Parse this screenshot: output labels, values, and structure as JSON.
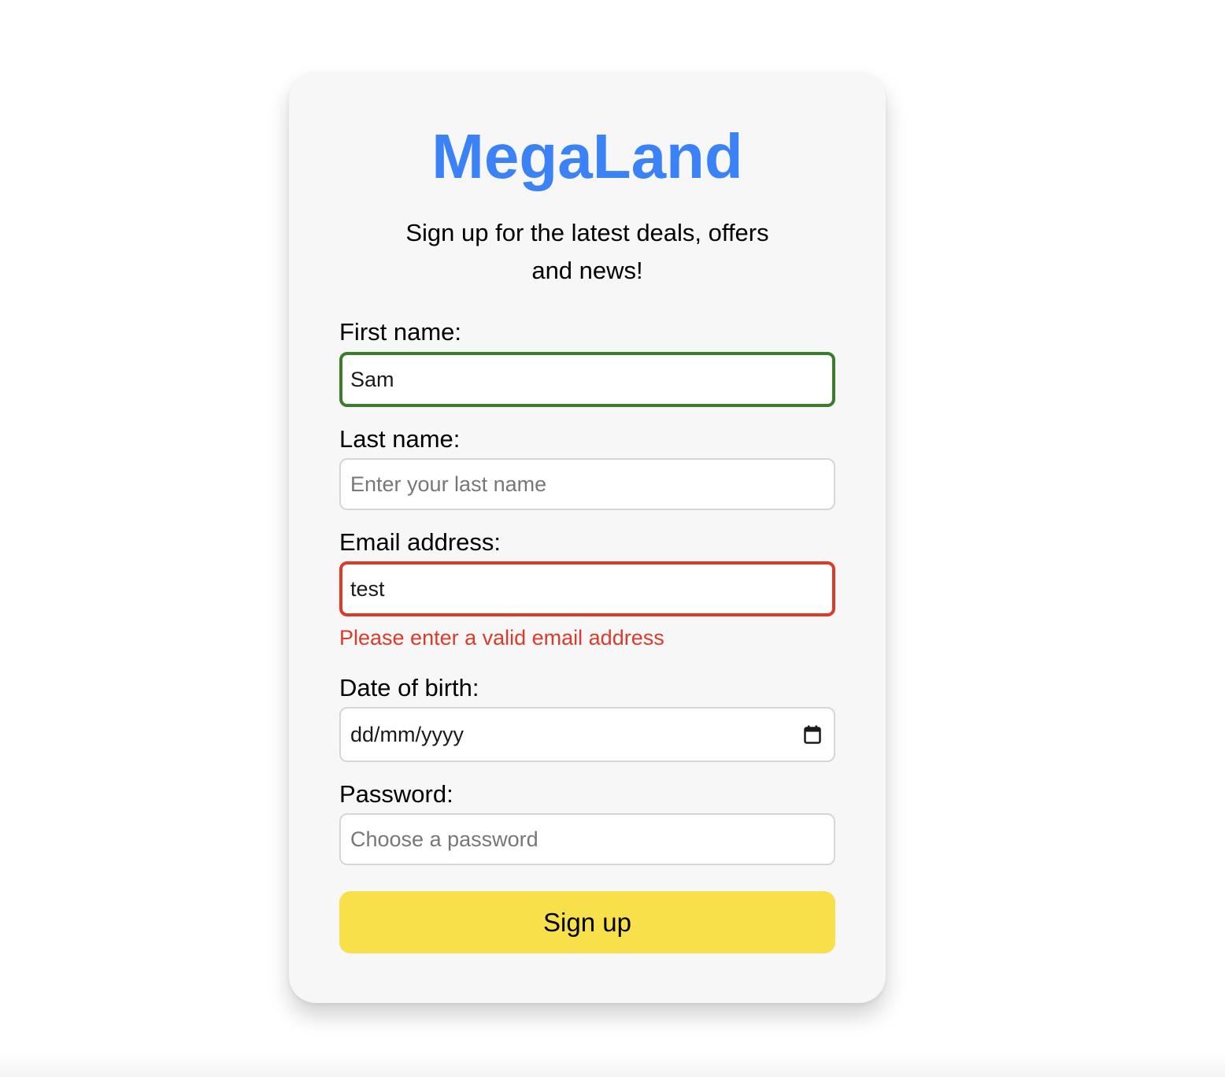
{
  "brand": {
    "title": "MegaLand",
    "color": "#3b82f6"
  },
  "tagline": "Sign up for the latest deals, offers and news!",
  "form": {
    "first_name": {
      "label": "First name:",
      "value": "Sam",
      "state": "valid",
      "state_color": "#3a7d2a"
    },
    "last_name": {
      "label": "Last name:",
      "value": "",
      "placeholder": "Enter your last name"
    },
    "email": {
      "label": "Email address:",
      "value": "test",
      "state": "invalid",
      "state_color": "#de3a2b",
      "error": "Please enter a valid email address"
    },
    "dob": {
      "label": "Date of birth:",
      "format_text": "dd/mm/yyyy",
      "icon": "calendar-icon"
    },
    "password": {
      "label": "Password:",
      "value": "",
      "placeholder": "Choose a password"
    },
    "submit_label": "Sign up",
    "submit_color": "#f8e04b"
  }
}
